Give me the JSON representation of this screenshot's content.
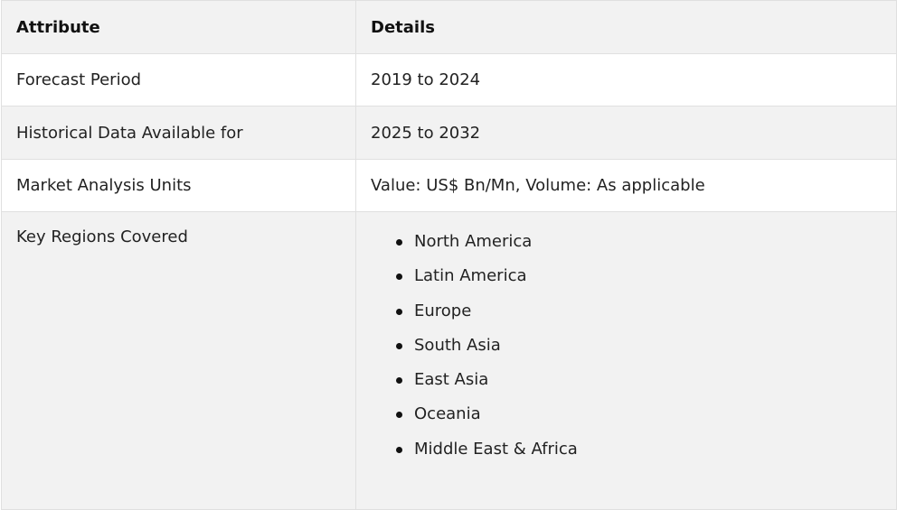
{
  "table": {
    "headers": {
      "attribute": "Attribute",
      "details": "Details"
    },
    "rows": [
      {
        "attribute": "Forecast Period",
        "details": "2019 to 2024"
      },
      {
        "attribute": "Historical Data Available for",
        "details": "2025 to 2032"
      },
      {
        "attribute": "Market Analysis Units",
        "details": "Value: US$ Bn/Mn, Volume: As applicable"
      }
    ],
    "regions": {
      "attribute": "Key Regions Covered",
      "items": [
        "North America",
        "Latin America",
        "Europe",
        "South Asia",
        "East Asia",
        "Oceania",
        "Middle East & Africa"
      ]
    }
  },
  "colors": {
    "header_bg": "#f2f2f2",
    "stripe_bg": "#f2f2f2",
    "row_bg": "#ffffff",
    "border": "#e0e0e0"
  }
}
